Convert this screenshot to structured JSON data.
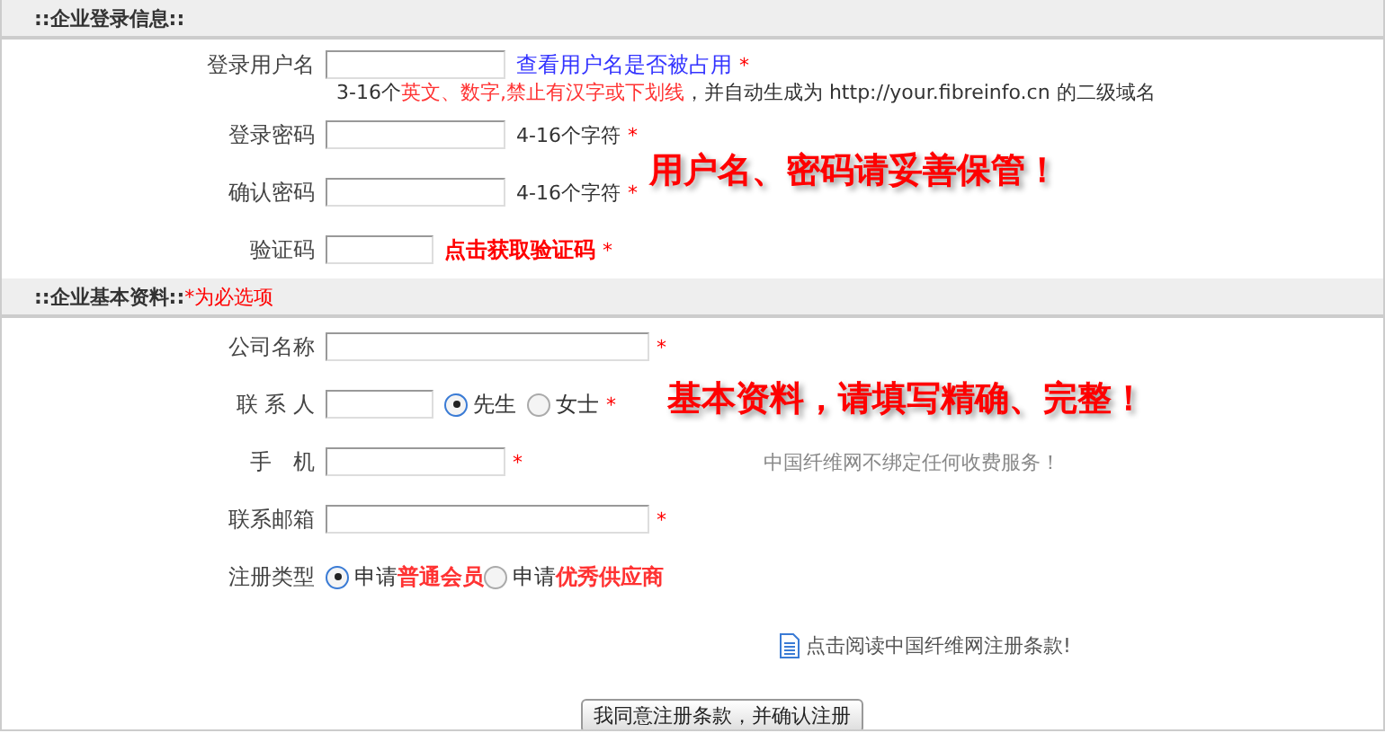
{
  "sections": [
    {
      "title": "::企业登录信息::",
      "rows": [
        {
          "label": "登录用户名",
          "kind": "field",
          "link": "查看用户名是否被占用",
          "required_mark": "*",
          "hint": [
            {
              "text": "3-16个",
              "emphasis": false
            },
            {
              "text": "英文、数字,禁止有汉字或下划线",
              "emphasis": true
            },
            {
              "text": "，并自动生成为 http://your.fibreinfo.cn 的二级域名",
              "emphasis": false
            }
          ]
        },
        {
          "label": "登录密码",
          "kind": "field",
          "note": "4-16个字符",
          "required_mark": "*"
        },
        {
          "label": "确认密码",
          "kind": "field",
          "note": "4-16个字符",
          "required_mark": "*"
        },
        {
          "label": "验证码",
          "kind": "short-field",
          "action": "点击获取验证码",
          "required_mark": "*"
        }
      ]
    },
    {
      "title": "::企业基本资料::",
      "title_note": "*为必选项",
      "rows": [
        {
          "label": "公司名称",
          "kind": "long-field",
          "required_mark": "*"
        },
        {
          "label": "联 系 人",
          "kind": "short-field",
          "options": [
            {
              "parts": [
                {
                  "text": "先生",
                  "emphasis": false
                }
              ],
              "selected": true
            },
            {
              "parts": [
                {
                  "text": "女士",
                  "emphasis": false
                }
              ],
              "selected": false
            }
          ],
          "required_mark": "*"
        },
        {
          "label": "手　机",
          "kind": "field",
          "required_mark": "*",
          "aside": "中国纤维网不绑定任何收费服务！"
        },
        {
          "label": "联系邮箱",
          "kind": "long-field",
          "required_mark": "*"
        },
        {
          "label": "注册类型",
          "kind": "choice",
          "options": [
            {
              "parts": [
                {
                  "text": "申请",
                  "emphasis": false
                },
                {
                  "text": "普通会员",
                  "emphasis": true
                }
              ],
              "selected": true
            },
            {
              "parts": [
                {
                  "text": "申请",
                  "emphasis": false
                },
                {
                  "text": "优秀供应商",
                  "emphasis": true
                }
              ],
              "selected": false
            }
          ]
        }
      ]
    }
  ],
  "callouts": [
    {
      "text": "用户名、密码请妥善保管！"
    },
    {
      "text": "基本资料，请填写精确、完整！"
    }
  ],
  "terms_link": "点击阅读中国纤维网注册条款!",
  "submit": "我同意注册条款，并确认注册"
}
